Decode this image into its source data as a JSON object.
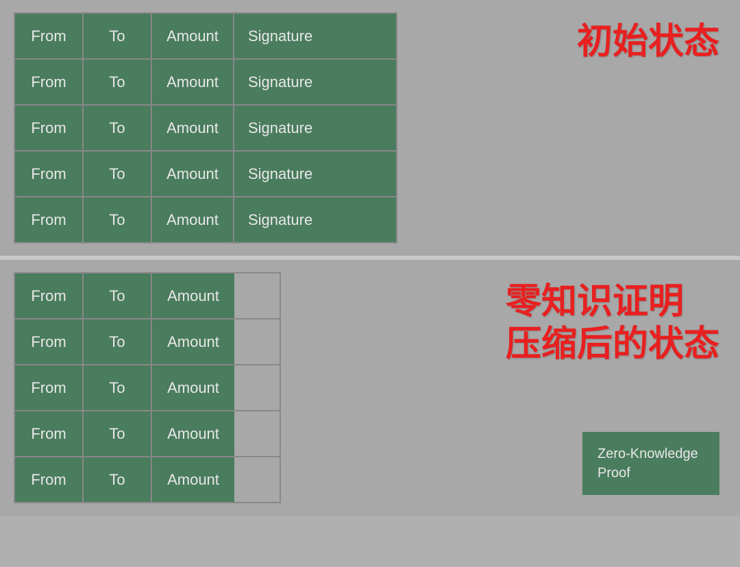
{
  "top_section": {
    "label": "初始状态",
    "rows": [
      {
        "from": "From",
        "to": "To",
        "amount": "Amount",
        "signature": "Signature"
      },
      {
        "from": "From",
        "to": "To",
        "amount": "Amount",
        "signature": "Signature"
      },
      {
        "from": "From",
        "to": "To",
        "amount": "Amount",
        "signature": "Signature"
      },
      {
        "from": "From",
        "to": "To",
        "amount": "Amount",
        "signature": "Signature"
      },
      {
        "from": "From",
        "to": "To",
        "amount": "Amount",
        "signature": "Signature"
      }
    ]
  },
  "bottom_section": {
    "label_line1": "零知识证明",
    "label_line2": "压缩后的状态",
    "zkp_box_text": "Zero-Knowledge Proof",
    "rows": [
      {
        "from": "From",
        "to": "To",
        "amount": "Amount"
      },
      {
        "from": "From",
        "to": "To",
        "amount": "Amount"
      },
      {
        "from": "From",
        "to": "To",
        "amount": "Amount"
      },
      {
        "from": "From",
        "to": "To",
        "amount": "Amount"
      },
      {
        "from": "From",
        "to": "To",
        "amount": "Amount"
      }
    ]
  }
}
